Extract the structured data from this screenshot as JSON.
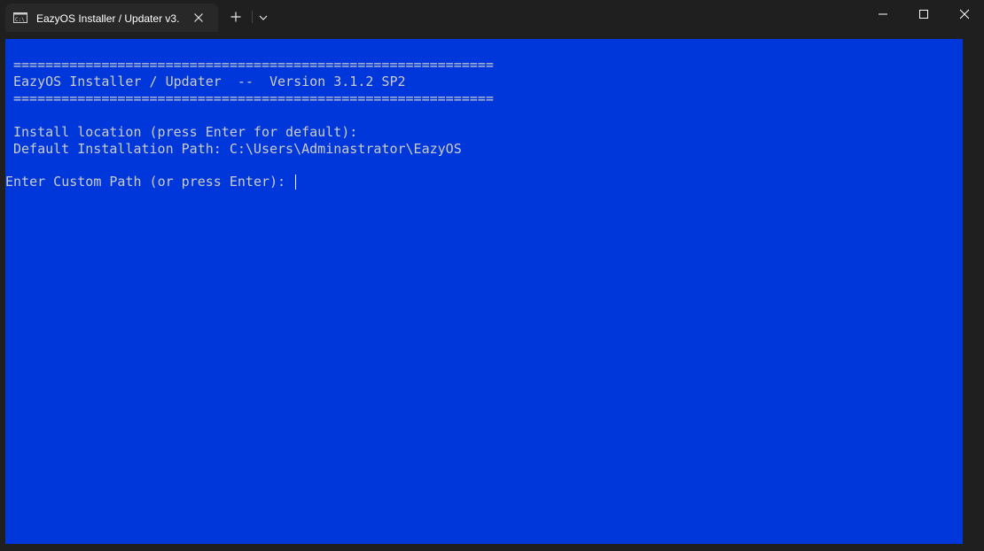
{
  "window": {
    "tab_title": "EazyOS Installer / Updater v3.",
    "tab_icon": "terminal-icon",
    "new_tab_icon": "plus-icon",
    "dropdown_icon": "chevron-down-icon",
    "controls": {
      "minimize_icon": "minimize-icon",
      "maximize_icon": "maximize-icon",
      "close_icon": "close-icon"
    }
  },
  "terminal": {
    "background_color": "#0037da",
    "text_color": "#cccccc",
    "lines": [
      "============================================================",
      "EazyOS Installer / Updater  --  Version 3.1.2 SP2",
      "============================================================",
      "Install location (press Enter for default):",
      "Default Installation Path: C:\\Users\\Adminastrator\\EazyOS"
    ],
    "prompt": {
      "label": "Enter Custom Path (or press Enter): ",
      "value": ""
    }
  }
}
